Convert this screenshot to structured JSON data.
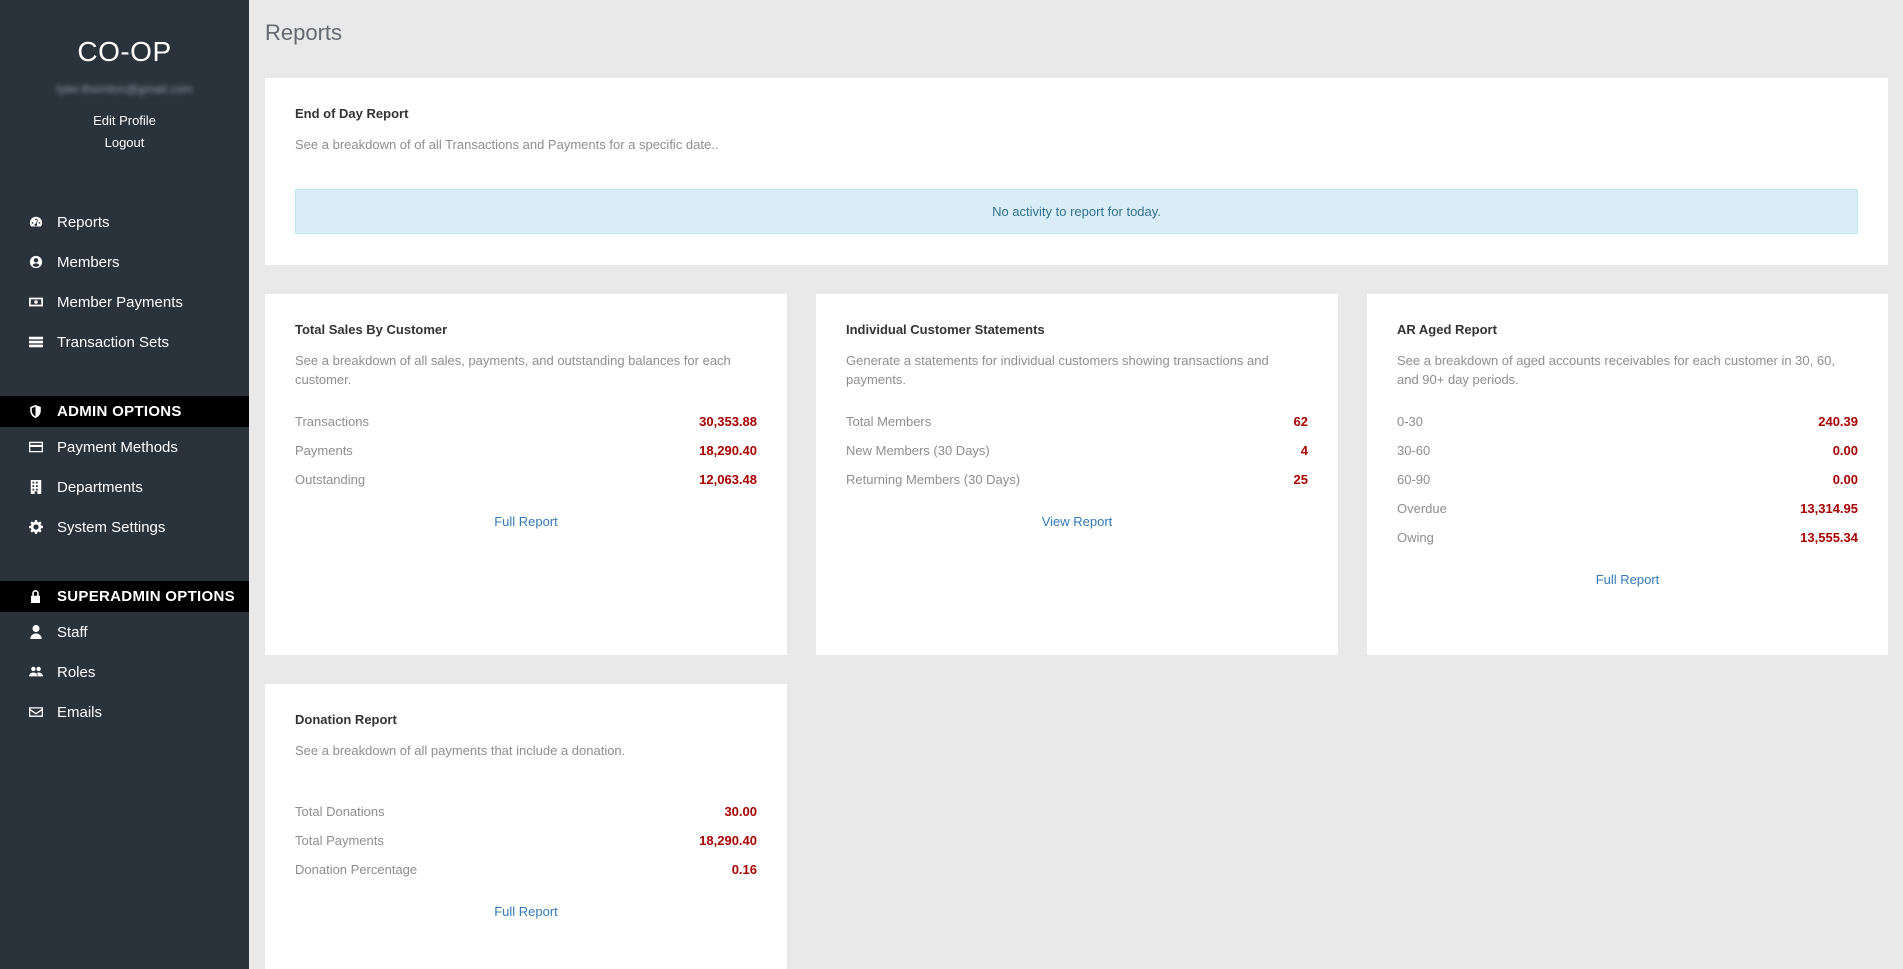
{
  "sidebar": {
    "brand": "CO-OP",
    "email": "tyler.thornton@gmail.com",
    "edit_profile": "Edit Profile",
    "logout": "Logout",
    "main_items": [
      {
        "label": "Reports",
        "icon": "dashboard-icon"
      },
      {
        "label": "Members",
        "icon": "user-circle-icon"
      },
      {
        "label": "Member Payments",
        "icon": "money-icon"
      },
      {
        "label": "Transaction Sets",
        "icon": "list-icon"
      }
    ],
    "admin_header": "ADMIN OPTIONS",
    "admin_items": [
      {
        "label": "Payment Methods",
        "icon": "credit-card-icon"
      },
      {
        "label": "Departments",
        "icon": "building-icon"
      },
      {
        "label": "System Settings",
        "icon": "gear-icon"
      }
    ],
    "superadmin_header": "SUPERADMIN OPTIONS",
    "superadmin_items": [
      {
        "label": "Staff",
        "icon": "user-icon"
      },
      {
        "label": "Roles",
        "icon": "users-icon"
      },
      {
        "label": "Emails",
        "icon": "envelope-icon"
      }
    ]
  },
  "main": {
    "title": "Reports",
    "end_of_day": {
      "title": "End of Day Report",
      "description": "See a breakdown of of all Transactions and Payments for a specific date..",
      "alert": "No activity to report for today."
    },
    "total_sales": {
      "title": "Total Sales By Customer",
      "description": "See a breakdown of all sales, payments, and outstanding balances for each customer.",
      "stats": [
        {
          "label": "Transactions",
          "value": "30,353.88"
        },
        {
          "label": "Payments",
          "value": "18,290.40"
        },
        {
          "label": "Outstanding",
          "value": "12,063.48"
        }
      ],
      "link": "Full Report"
    },
    "statements": {
      "title": "Individual Customer Statements",
      "description": "Generate a statements for individual customers showing transactions and payments.",
      "stats": [
        {
          "label": "Total Members",
          "value": "62"
        },
        {
          "label": "New Members (30 Days)",
          "value": "4"
        },
        {
          "label": "Returning Members (30 Days)",
          "value": "25"
        }
      ],
      "link": "View Report"
    },
    "ar_aged": {
      "title": "AR Aged Report",
      "description": "See a breakdown of aged accounts receivables for each customer in 30, 60, and 90+ day periods.",
      "stats": [
        {
          "label": "0-30",
          "value": "240.39"
        },
        {
          "label": "30-60",
          "value": "0.00"
        },
        {
          "label": "60-90",
          "value": "0.00"
        },
        {
          "label": "Overdue",
          "value": "13,314.95"
        },
        {
          "label": "Owing",
          "value": "13,555.34"
        }
      ],
      "link": "Full Report"
    },
    "donation": {
      "title": "Donation Report",
      "description": "See a breakdown of all payments that include a donation.",
      "stats": [
        {
          "label": "Total Donations",
          "value": "30.00"
        },
        {
          "label": "Total Payments",
          "value": "18,290.40"
        },
        {
          "label": "Donation Percentage",
          "value": "0.16"
        }
      ],
      "link": "Full Report"
    }
  }
}
